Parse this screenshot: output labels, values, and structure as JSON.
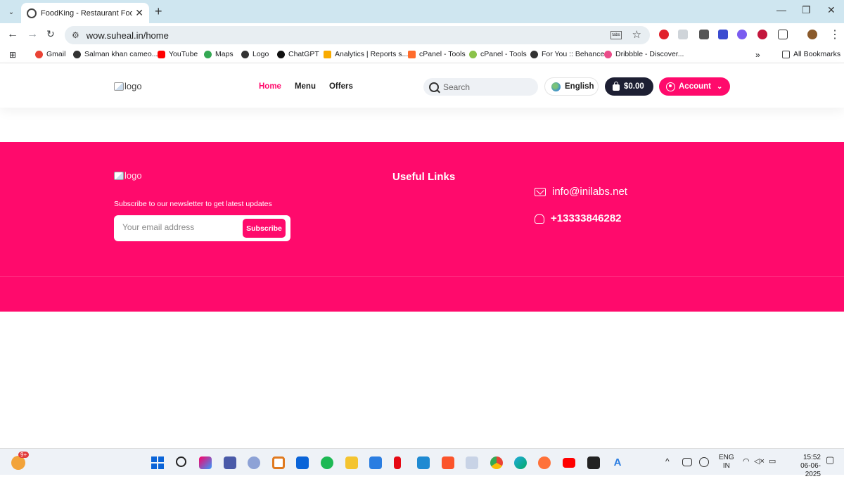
{
  "browser": {
    "tab": {
      "title": "FoodKing - Restaurant Food Or"
    },
    "address": {
      "url": "wow.suheal.in/home"
    },
    "bookmarks": [
      {
        "label": "Gmail",
        "color": "#ea4335"
      },
      {
        "label": "Salman khan cameo...",
        "color": "#333333"
      },
      {
        "label": "YouTube",
        "color": "#ff0000"
      },
      {
        "label": "Maps",
        "color": "#34a853"
      },
      {
        "label": "Logo",
        "color": "#333333"
      },
      {
        "label": "ChatGPT",
        "color": "#111111"
      },
      {
        "label": "Analytics | Reports s...",
        "color": "#f9ab00"
      },
      {
        "label": "cPanel - Tools",
        "color": "#ff6c2c"
      },
      {
        "label": "cPanel - Tools",
        "color": "#8bc34a"
      },
      {
        "label": "For You :: Behance",
        "color": "#333333"
      },
      {
        "label": "Dribbble - Discover...",
        "color": "#ea4c89"
      }
    ],
    "overflow_label": "»",
    "all_bookmarks": "All Bookmarks"
  },
  "header": {
    "logo_alt": "logo",
    "nav": [
      {
        "label": "Home",
        "active": true
      },
      {
        "label": "Menu",
        "active": false
      },
      {
        "label": "Offers",
        "active": false
      }
    ],
    "search_placeholder": "Search",
    "language": "English",
    "cart_total": "$0.00",
    "account_label": "Account"
  },
  "footer": {
    "logo_alt": "logo",
    "newsletter_text": "Subscribe to our newsletter to get latest updates",
    "email_placeholder": "Your email address",
    "subscribe_label": "Subscribe",
    "useful_links_title": "Useful Links",
    "email": "info@inilabs.net",
    "phone": "+13333846282"
  },
  "taskbar": {
    "weather_badge": "9+",
    "lang_top": "ENG",
    "lang_bottom": "IN",
    "time": "15:52",
    "date": "06-06-2025"
  },
  "colors": {
    "brand": "#ff0a6c",
    "dark": "#1d1f33"
  }
}
